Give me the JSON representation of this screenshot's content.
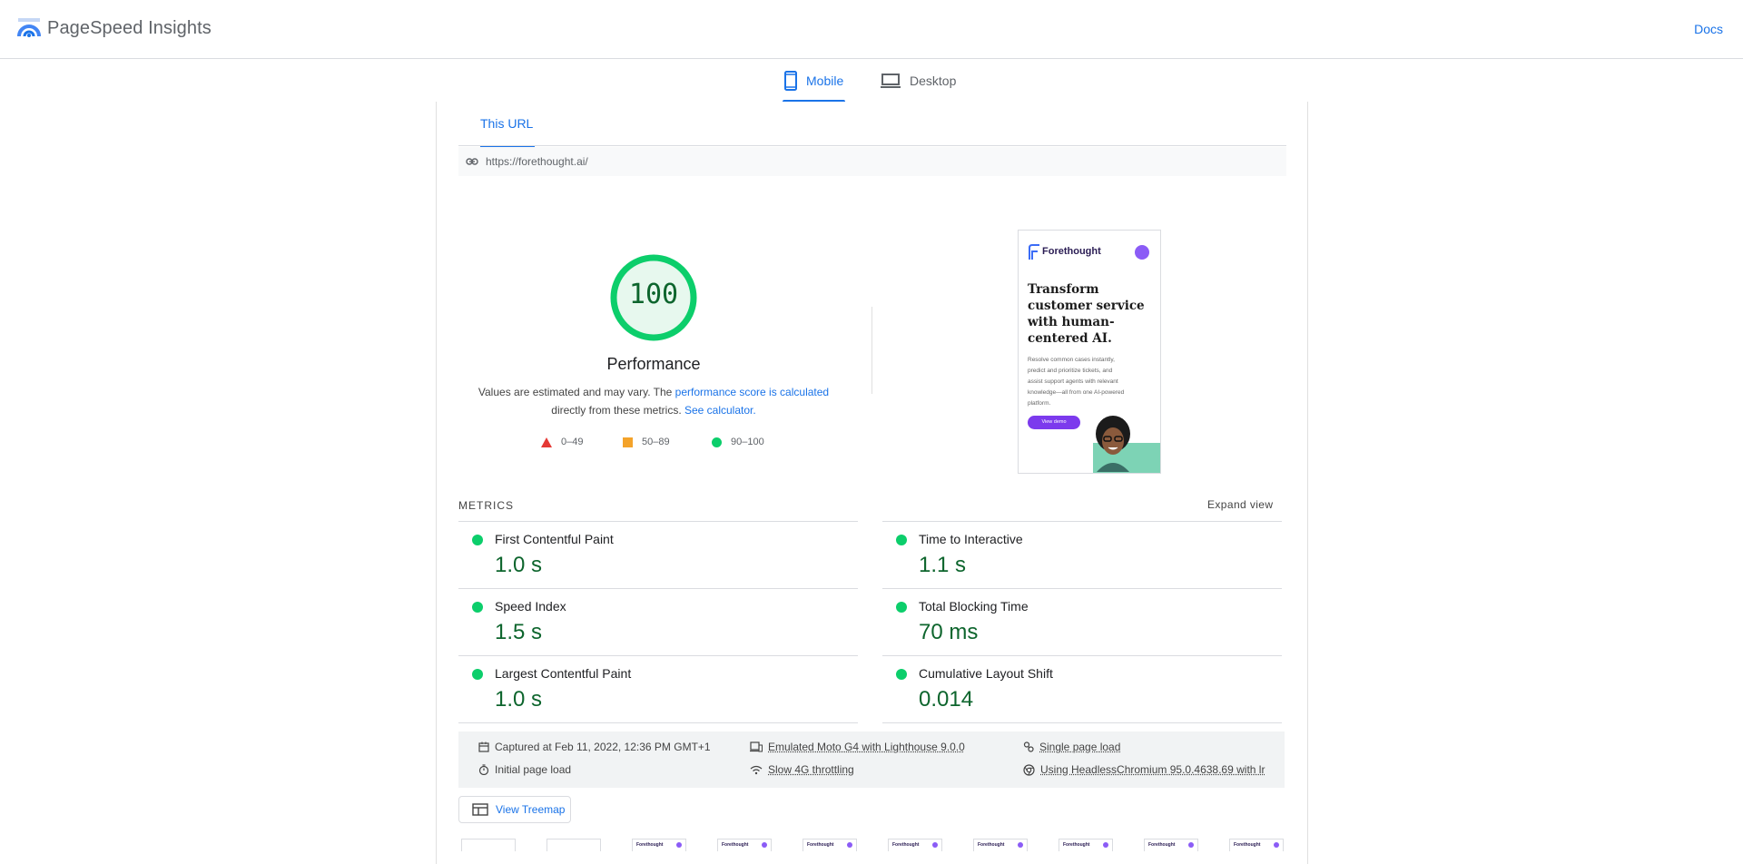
{
  "header": {
    "brand": "PageSpeed Insights",
    "docs_label": "Docs"
  },
  "device_tabs": {
    "mobile_label": "Mobile",
    "desktop_label": "Desktop",
    "selected": "Mobile"
  },
  "url_tab": {
    "label": "This URL"
  },
  "url": "https://forethought.ai/",
  "performance": {
    "score": "100",
    "score_value": 100,
    "title": "Performance",
    "desc_part1": "Values are estimated and may vary. The ",
    "desc_link1": "performance score is calculated",
    "desc_part2": "directly from these metrics. ",
    "desc_link2": "See calculator.",
    "legend": [
      {
        "label": "0–49",
        "color": "#e53935",
        "shape": "triangle"
      },
      {
        "label": "50–89",
        "color": "#f4a32a",
        "shape": "square"
      },
      {
        "label": "90–100",
        "color": "#0cce6b",
        "shape": "circle"
      }
    ],
    "gauge_color": "#0cce6b",
    "gauge_fill": "#e7f8ee"
  },
  "screenshot": {
    "brand": "Forethought",
    "headline_lines": [
      "Transform",
      "customer service",
      "with human-",
      "centered AI."
    ],
    "subtext_lines": [
      "Resolve common cases instantly,",
      "predict and prioritize tickets, and",
      "assist support agents with relevant",
      "knowledge—all from one AI-powered",
      "platform."
    ],
    "button": "View demo"
  },
  "metrics": {
    "heading": "METRICS",
    "expand_label": "Expand view",
    "items": [
      {
        "name": "First Contentful Paint",
        "value": "1.0 s"
      },
      {
        "name": "Time to Interactive",
        "value": "1.1 s"
      },
      {
        "name": "Speed Index",
        "value": "1.5 s"
      },
      {
        "name": "Total Blocking Time",
        "value": "70 ms"
      },
      {
        "name": "Largest Contentful Paint",
        "value": "1.0 s"
      },
      {
        "name": "Cumulative Layout Shift",
        "value": "0.014"
      }
    ]
  },
  "run_info": {
    "captured": "Captured at Feb 11, 2022, 12:36 PM GMT+1",
    "initial_load": "Initial page load",
    "emulated": "Emulated Moto G4 with Lighthouse 9.0.0",
    "throttling": "Slow 4G throttling",
    "single_page": "Single page load",
    "browser": "Using HeadlessChromium 95.0.4638.69 with lr"
  },
  "treemap_label": "View Treemap",
  "filmstrip_brand": "Forethought",
  "colors": {
    "accent": "#1a73e8",
    "pass": "#0cce6b",
    "pass_text": "#0d652d"
  }
}
